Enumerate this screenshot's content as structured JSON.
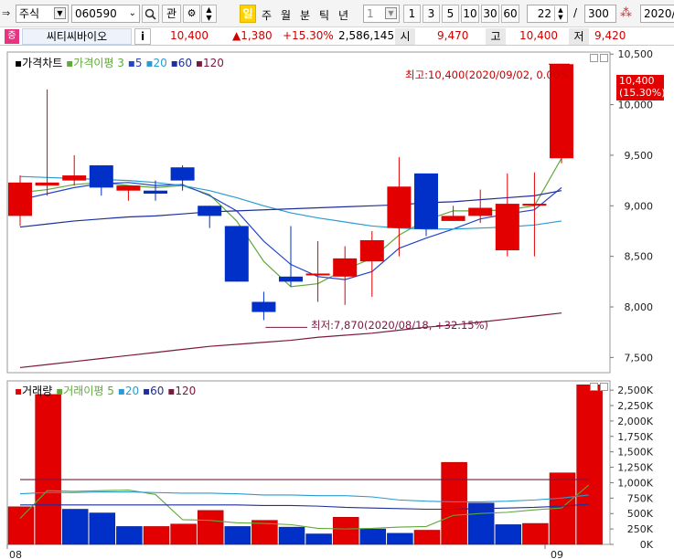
{
  "toolbar": {
    "market_select": "주식",
    "code_input": "060590",
    "search_icon": "search-icon",
    "watch_label": "관",
    "mode_active": "일",
    "periods": [
      "주",
      "월",
      "분",
      "틱",
      "년"
    ],
    "unit_value": "1",
    "minute_buttons": [
      "1",
      "3",
      "5",
      "10",
      "30",
      "60"
    ],
    "count_value": "22",
    "count_total": "300",
    "date_value": "2020/0"
  },
  "quote": {
    "badge": "증",
    "name": "씨티씨바이오",
    "info_label": "i",
    "price": "10,400",
    "change": "▲1,380",
    "change_rate": "+15.30%",
    "volume": "2,586,145",
    "open_label": "시",
    "open": "9,470",
    "high_label": "고",
    "high": "10,400",
    "low_label": "저",
    "low": "9,420"
  },
  "price_legend": {
    "price_label": "가격차트",
    "ma_label": "가격이평",
    "ma_periods": [
      "3",
      "5",
      "20",
      "60",
      "120"
    ]
  },
  "volume_legend": {
    "volume_label": "거래량",
    "ma_label": "거래이평",
    "ma_periods": [
      "5",
      "20",
      "60",
      "120"
    ]
  },
  "annotations": {
    "high_note": "최고:10,400(2020/09/02, 0.00%)",
    "low_note": "최저:7,870(2020/08/18, +32.15%)",
    "last_price_tag": "10,400",
    "last_rate_tag": "(15.30%)"
  },
  "colors": {
    "up": "#e20000",
    "down": "#0030c8",
    "ma3": "#5fa83a",
    "ma5": "#2545c8",
    "ma20": "#2a9bd0",
    "ma60": "#1c2f9c",
    "ma120": "#7a1840",
    "volume": "#e20000"
  },
  "chart_data": {
    "type": "candlestick",
    "x": [
      "08/04",
      "08/05",
      "08/06",
      "08/07",
      "08/10",
      "08/11",
      "08/12",
      "08/13",
      "08/14",
      "08/18",
      "08/19",
      "08/20",
      "08/21",
      "08/24",
      "08/25",
      "08/26",
      "08/27",
      "08/28",
      "08/31",
      "09/01",
      "09/02"
    ],
    "x_tick_labels": [
      "08",
      "09"
    ],
    "open": [
      8900,
      9200,
      9250,
      9400,
      9150,
      9150,
      9380,
      9000,
      8800,
      8050,
      8300,
      8330,
      8300,
      8450,
      8780,
      9320,
      8850,
      8900,
      8560,
      9020,
      9470
    ],
    "high": [
      9300,
      10150,
      9500,
      9400,
      9200,
      9250,
      9400,
      9000,
      8800,
      8150,
      8800,
      8650,
      8600,
      8750,
      9480,
      9320,
      9000,
      9160,
      9320,
      9330,
      10400
    ],
    "low": [
      8800,
      9100,
      9200,
      9100,
      9050,
      9050,
      9150,
      8780,
      8250,
      7870,
      8200,
      8050,
      8020,
      8100,
      8500,
      8700,
      8850,
      8830,
      8500,
      8500,
      9420
    ],
    "close": [
      9230,
      9230,
      9300,
      9180,
      9200,
      9120,
      9250,
      8900,
      8250,
      7950,
      8250,
      8330,
      8480,
      8660,
      9190,
      8770,
      8900,
      8980,
      9020,
      9020,
      10400
    ],
    "price_axis_ticks": [
      10500,
      10000,
      9500,
      9000,
      8500,
      8000,
      7500
    ],
    "price_ylim": [
      7350,
      10520
    ],
    "ma_lines": [
      {
        "period": "3",
        "values": [
          9130,
          9160,
          9210,
          9230,
          9200,
          9180,
          9200,
          9110,
          8850,
          8450,
          8200,
          8230,
          8370,
          8480,
          8710,
          8860,
          8950,
          8950,
          8960,
          9000,
          9470
        ]
      },
      {
        "period": "5",
        "values": [
          9060,
          9120,
          9180,
          9220,
          9230,
          9200,
          9210,
          9100,
          8950,
          8650,
          8420,
          8300,
          8270,
          8350,
          8580,
          8680,
          8770,
          8870,
          8920,
          8960,
          9180
        ]
      },
      {
        "period": "20",
        "values": [
          9290,
          9280,
          9270,
          9260,
          9250,
          9230,
          9200,
          9150,
          9080,
          9000,
          8930,
          8880,
          8840,
          8800,
          8780,
          8770,
          8770,
          8780,
          8790,
          8810,
          8850
        ]
      },
      {
        "period": "60",
        "values": [
          8790,
          8820,
          8850,
          8870,
          8890,
          8900,
          8920,
          8940,
          8950,
          8960,
          8970,
          8980,
          8990,
          9000,
          9010,
          9030,
          9040,
          9060,
          9080,
          9100,
          9150
        ]
      },
      {
        "period": "120",
        "values": [
          7400,
          7430,
          7460,
          7490,
          7520,
          7550,
          7580,
          7610,
          7630,
          7650,
          7670,
          7700,
          7720,
          7740,
          7770,
          7800,
          7820,
          7850,
          7880,
          7910,
          7940
        ]
      }
    ],
    "volume": [
      610000,
      2430000,
      570000,
      510000,
      290000,
      290000,
      330000,
      550000,
      290000,
      390000,
      280000,
      170000,
      440000,
      250000,
      180000,
      230000,
      1330000,
      670000,
      320000,
      340000,
      1160000,
      2586145
    ],
    "volume_axis_ticks": [
      "2,500K",
      "2,250K",
      "2,000K",
      "1,750K",
      "1,500K",
      "1,250K",
      "1,000K",
      "750K",
      "500K",
      "250K",
      "0K"
    ],
    "volume_ylim": [
      0,
      2650000
    ],
    "volume_ma_lines": [
      {
        "period": "5",
        "values": [
          420000,
          870000,
          860000,
          870000,
          880000,
          810000,
          400000,
          390000,
          350000,
          340000,
          320000,
          260000,
          250000,
          260000,
          280000,
          290000,
          470000,
          500000,
          520000,
          560000,
          590000,
          960000
        ]
      },
      {
        "period": "20",
        "values": [
          820000,
          840000,
          840000,
          850000,
          850000,
          840000,
          830000,
          830000,
          820000,
          800000,
          800000,
          790000,
          790000,
          770000,
          720000,
          700000,
          690000,
          690000,
          700000,
          720000,
          750000,
          800000
        ]
      },
      {
        "period": "60",
        "values": [
          640000,
          640000,
          640000,
          640000,
          640000,
          640000,
          640000,
          640000,
          640000,
          630000,
          630000,
          620000,
          600000,
          590000,
          580000,
          570000,
          570000,
          580000,
          590000,
          600000,
          620000,
          650000
        ]
      },
      {
        "period": "120",
        "values": [
          1050000,
          1050000,
          1050000,
          1050000,
          1050000,
          1050000,
          1050000,
          1050000,
          1050000,
          1050000,
          1050000,
          1050000,
          1050000,
          1050000,
          1050000,
          1050000,
          1050000,
          1050000,
          1050000,
          1050000,
          1050000,
          1050000
        ]
      }
    ]
  }
}
